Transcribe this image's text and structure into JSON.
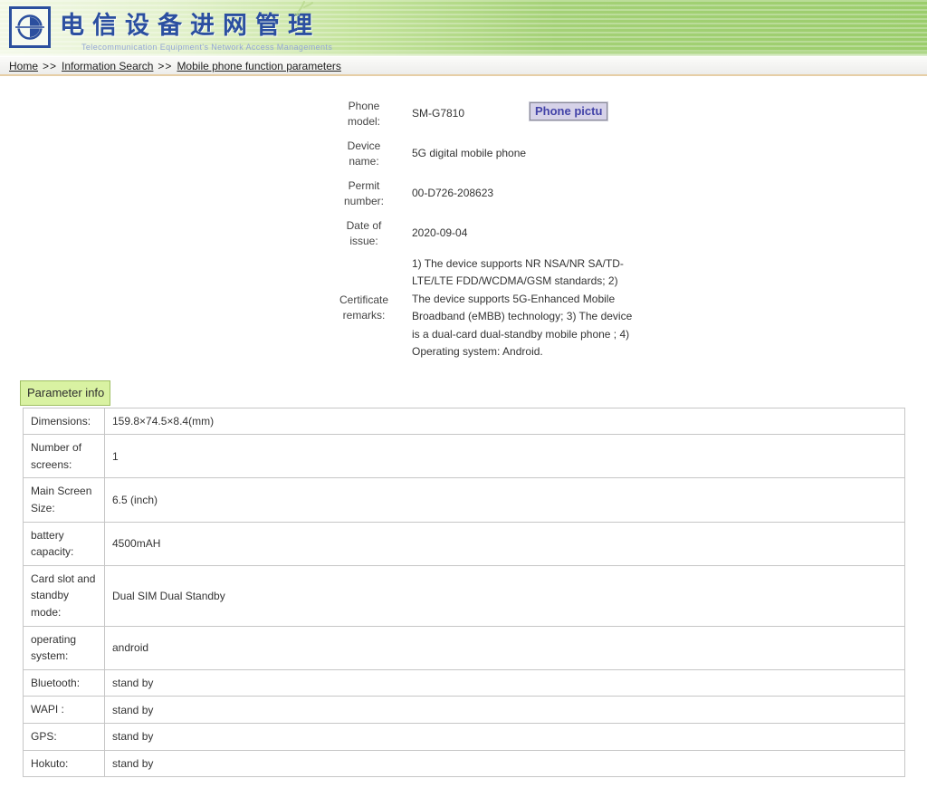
{
  "header": {
    "title_cn": "电信设备进网管理",
    "subtitle_en": "Telecommunication Equipment's Network Access Managements"
  },
  "breadcrumb": {
    "separator": ">>",
    "items": [
      "Home",
      "Information Search",
      "Mobile phone function parameters"
    ]
  },
  "form": {
    "photo_button_label": "Phone pictu",
    "fields": [
      {
        "label": "Phone model:",
        "value": "SM-G7810"
      },
      {
        "label": "Device name:",
        "value": "5G digital mobile phone"
      },
      {
        "label": "Permit number:",
        "value": "00-D726-208623"
      },
      {
        "label": "Date of issue:",
        "value": "2020-09-04"
      },
      {
        "label": "Certificate remarks:",
        "value": "1) The device supports NR NSA/NR SA/TD-LTE/LTE FDD/WCDMA/GSM standards; 2) The device supports 5G-Enhanced Mobile Broadband (eMBB) technology; 3) The device is a dual-card dual-standby mobile phone ; 4) Operating system: Android."
      }
    ]
  },
  "parameters": {
    "tab_label": "Parameter info",
    "rows": [
      {
        "label": "Dimensions:",
        "value": "159.8×74.5×8.4(mm)"
      },
      {
        "label": "Number of screens:",
        "value": "1"
      },
      {
        "label": "Main Screen Size:",
        "value": "6.5 (inch)"
      },
      {
        "label": "battery capacity:",
        "value": "4500mAH"
      },
      {
        "label": "Card slot and standby mode:",
        "value": "Dual SIM Dual Standby"
      },
      {
        "label": "operating system:",
        "value": "android"
      },
      {
        "label": "Bluetooth:",
        "value": "stand by"
      },
      {
        "label": "WAPI :",
        "value": "stand by"
      },
      {
        "label": "GPS:",
        "value": "stand by"
      },
      {
        "label": "Hokuto:",
        "value": "stand by"
      }
    ]
  },
  "colors": {
    "banner_green": "#9bcd6c",
    "title_blue": "#2b4fa0",
    "subtitle_blue": "#93a7d4",
    "breadcrumb_border_tan": "#e6cea6",
    "tab_background": "#d9f2a2",
    "tab_border": "#9fbf63",
    "button_background": "#d6d2e8",
    "button_text": "#4343a8",
    "table_border": "#c6c6c6"
  }
}
